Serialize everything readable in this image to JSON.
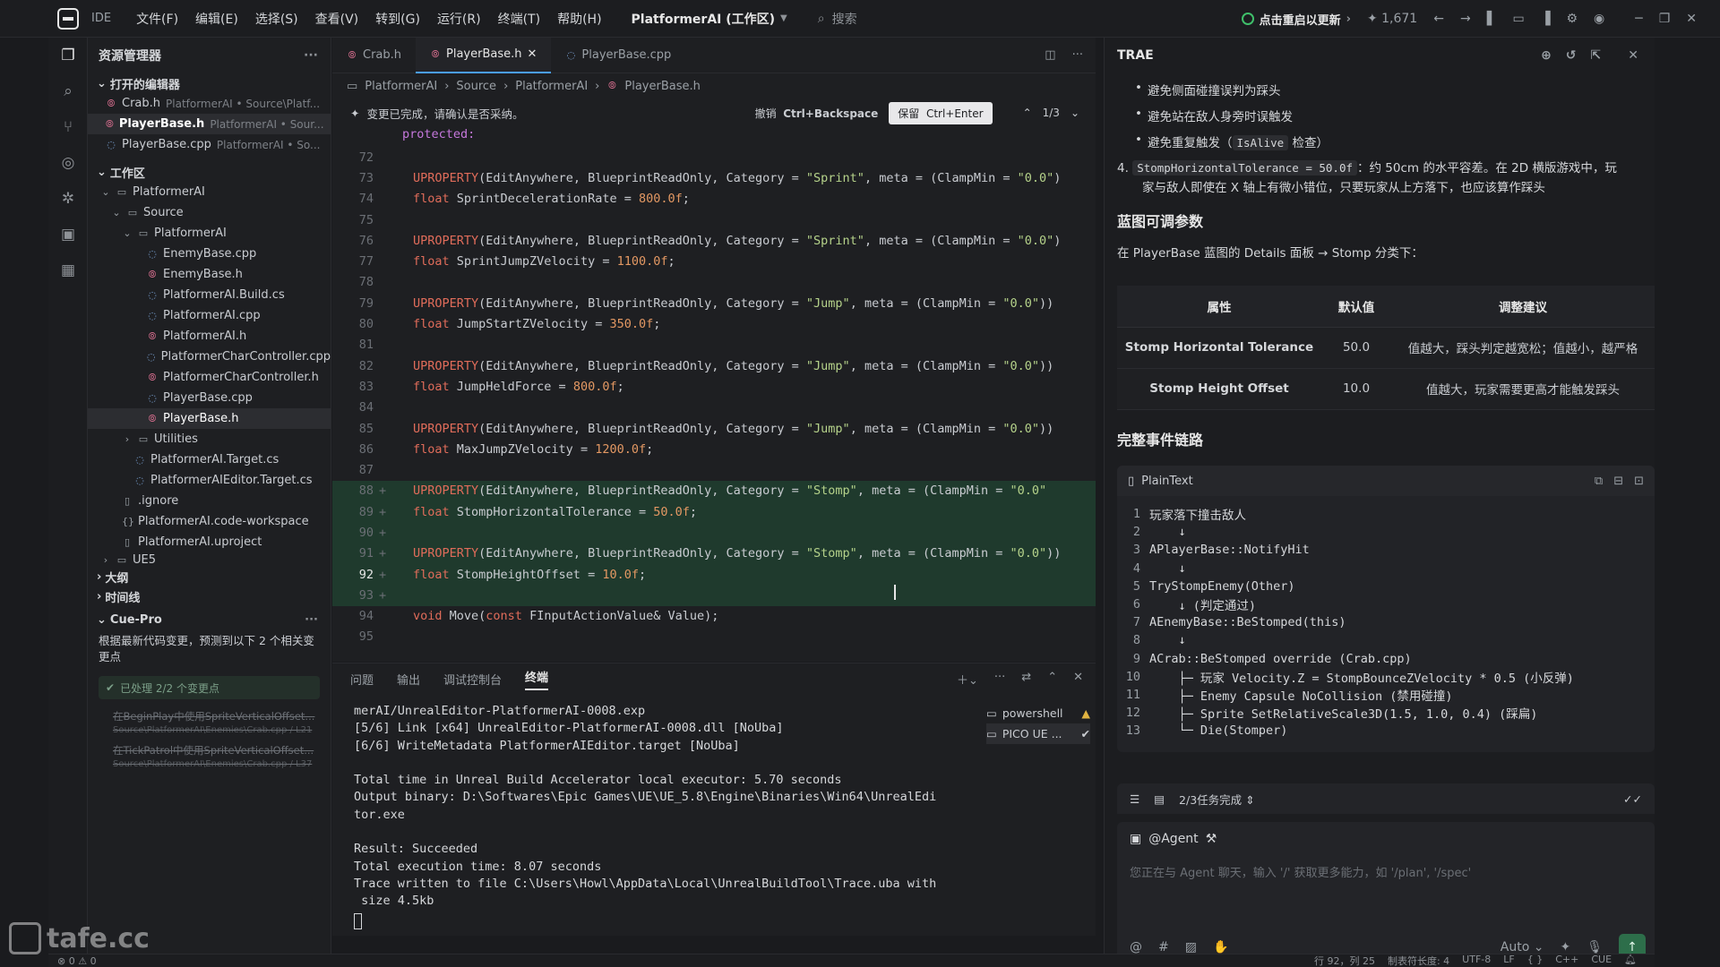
{
  "titlebar": {
    "badge": "IDE",
    "menu": [
      "文件(F)",
      "编辑(E)",
      "选择(S)",
      "查看(V)",
      "转到(G)",
      "运行(R)",
      "终端(T)",
      "帮助(H)"
    ],
    "project": "PlatformerAI (工作区)",
    "search": "搜索",
    "update": "点击重启以更新",
    "count": "1,671"
  },
  "sidebar": {
    "title": "资源管理器",
    "open_editors_title": "打开的编辑器",
    "open_editors": [
      {
        "name": "Crab.h",
        "path": "PlatformerAI • Source\\Platf..."
      },
      {
        "name": "PlayerBase.h",
        "path": "PlatformerAI • Sour..."
      },
      {
        "name": "PlayerBase.cpp",
        "path": "PlatformerAI • So..."
      }
    ],
    "workspace_title": "工作区",
    "tree": {
      "root": "PlatformerAI",
      "source": "Source",
      "sub": "PlatformerAI",
      "files": [
        "EnemyBase.cpp",
        "EnemyBase.h",
        "PlatformerAI.Build.cs",
        "PlatformerAI.cpp",
        "PlatformerAI.h",
        "PlatformerCharController.cpp",
        "PlatformerCharController.h",
        "PlayerBase.cpp",
        "PlayerBase.h"
      ],
      "utilities": "Utilities",
      "targets": [
        "PlatformerAI.Target.cs",
        "PlatformerAIEditor.Target.cs"
      ],
      "root_files": [
        ".ignore",
        "PlatformerAI.code-workspace",
        "PlatformerAI.uproject"
      ],
      "ue5": "UE5"
    },
    "outline": "大纲",
    "timeline": "时间线",
    "cue": {
      "title": "Cue-Pro",
      "note": "根据最新代码变更，预测到以下 2 个相关变更点",
      "done": "已处理 2/2 个变更点",
      "items": [
        {
          "text": "在BeginPlay中使用SpriteVerticalOffset...",
          "path": "Source\\PlatformerAI\\Enemies\\Crab.cpp / L21"
        },
        {
          "text": "在TickPatrol中使用SpriteVerticalOffset...",
          "path": "Source\\PlatformerAI\\Enemies\\Crab.cpp / L37"
        }
      ]
    }
  },
  "editor": {
    "tabs": [
      "Crab.h",
      "PlayerBase.h",
      "PlayerBase.cpp"
    ],
    "breadcrumb": [
      "PlatformerAI",
      "Source",
      "PlatformerAI",
      "PlayerBase.h"
    ],
    "change_bar": {
      "message": "变更已完成，请确认是否采纳。",
      "undo": "撤销",
      "undo_key": "Ctrl+Backspace",
      "keep": "保留",
      "keep_key": "Ctrl+Enter",
      "counter": "1/3"
    },
    "sticky": "protected:",
    "lines": [
      {
        "n": "72",
        "code": ""
      },
      {
        "n": "73",
        "code": "UPROPERTY(EditAnywhere, BlueprintReadOnly, Category = \"Sprint\", meta = (ClampMin = \"0.0\")"
      },
      {
        "n": "74",
        "code": "float SprintDecelerationRate = 800.0f;"
      },
      {
        "n": "75",
        "code": ""
      },
      {
        "n": "76",
        "code": "UPROPERTY(EditAnywhere, BlueprintReadOnly, Category = \"Sprint\", meta = (ClampMin = \"0.0\")"
      },
      {
        "n": "77",
        "code": "float SprintJumpZVelocity = 1100.0f;"
      },
      {
        "n": "78",
        "code": ""
      },
      {
        "n": "79",
        "code": "UPROPERTY(EditAnywhere, BlueprintReadOnly, Category = \"Jump\", meta = (ClampMin = \"0.0\"))"
      },
      {
        "n": "80",
        "code": "float JumpStartZVelocity = 350.0f;"
      },
      {
        "n": "81",
        "code": ""
      },
      {
        "n": "82",
        "code": "UPROPERTY(EditAnywhere, BlueprintReadOnly, Category = \"Jump\", meta = (ClampMin = \"0.0\"))"
      },
      {
        "n": "83",
        "code": "float JumpHeldForce = 800.0f;"
      },
      {
        "n": "84",
        "code": ""
      },
      {
        "n": "85",
        "code": "UPROPERTY(EditAnywhere, BlueprintReadOnly, Category = \"Jump\", meta = (ClampMin = \"0.0\"))"
      },
      {
        "n": "86",
        "code": "float MaxJumpZVelocity = 1200.0f;"
      },
      {
        "n": "87",
        "code": ""
      },
      {
        "n": "88",
        "code": "UPROPERTY(EditAnywhere, BlueprintReadOnly, Category = \"Stomp\", meta = (ClampMin = \"0.0\"",
        "added": true
      },
      {
        "n": "89",
        "code": "float StompHorizontalTolerance = 50.0f;",
        "added": true
      },
      {
        "n": "90",
        "code": "",
        "added": true
      },
      {
        "n": "91",
        "code": "UPROPERTY(EditAnywhere, BlueprintReadOnly, Category = \"Stomp\", meta = (ClampMin = \"0.0\"))",
        "added": true
      },
      {
        "n": "92",
        "code": "float StompHeightOffset = 10.0f;",
        "added": true,
        "current": true
      },
      {
        "n": "93",
        "code": "",
        "added": true
      },
      {
        "n": "94",
        "code": "void Move(const FInputActionValue& Value);"
      },
      {
        "n": "95",
        "code": ""
      }
    ]
  },
  "terminal": {
    "tabs": [
      "问题",
      "输出",
      "调试控制台",
      "终端"
    ],
    "output": "merAI/UnrealEditor-PlatformerAI-0008.exp\n[5/6] Link [x64] UnrealEditor-PlatformerAI-0008.dll [NoUba]\n[6/6] WriteMetadata PlatformerAIEditor.target [NoUba]\n\nTotal time in Unreal Build Accelerator local executor: 5.70 seconds\nOutput binary: D:\\Softwares\\Epic Games\\UE\\UE_5.8\\Engine\\Binaries\\Win64\\UnrealEdi\ntor.exe\n\nResult: Succeeded\nTotal execution time: 8.07 seconds\nTrace written to file C:\\Users\\Howl\\AppData\\Local\\UnrealBuildTool\\Trace.uba with\n size 4.5kb",
    "sessions": [
      "powershell",
      "PICO UE ..."
    ]
  },
  "trae": {
    "title": "TRAE",
    "bullets": [
      "避免侧面碰撞误判为踩头",
      "避免站在敌人身旁时误触发"
    ],
    "bullet3_pre": "避免重复触发（",
    "bullet3_code": "IsAlive",
    "bullet3_post": " 检查）",
    "item4_num": "4.",
    "item4_code": "StompHorizontalTolerance = 50.0f",
    "item4_text": "：约 50cm 的水平容差。在 2D 横版游戏中，玩",
    "item4_text2": "家与敌人即使在 X 轴上有微小错位，只要玩家从上方落下，也应该算作踩头",
    "h_params": "蓝图可调参数",
    "params_desc": "在 PlayerBase 蓝图的 Details 面板 → Stomp 分类下：",
    "table": {
      "headers": [
        "属性",
        "默认值",
        "调整建议"
      ],
      "rows": [
        [
          "Stomp Horizontal Tolerance",
          "50.0",
          "值越大，踩头判定越宽松；值越小，越严格"
        ],
        [
          "Stomp Height Offset",
          "10.0",
          "值越大，玩家需要更高才能触发踩头"
        ]
      ]
    },
    "h_chain": "完整事件链路",
    "code_lang": "PlainText",
    "code_lines": [
      {
        "n": "1",
        "t": "玩家落下撞击敌人"
      },
      {
        "n": "2",
        "t": "    ↓"
      },
      {
        "n": "3",
        "t": "APlayerBase::NotifyHit"
      },
      {
        "n": "4",
        "t": "    ↓"
      },
      {
        "n": "5",
        "t": "TryStompEnemy(Other)"
      },
      {
        "n": "6",
        "t": "    ↓ (判定通过)"
      },
      {
        "n": "7",
        "t": "AEnemyBase::BeStomped(this)"
      },
      {
        "n": "8",
        "t": "    ↓"
      },
      {
        "n": "9",
        "t": "ACrab::BeStomped override (Crab.cpp)"
      },
      {
        "n": "10",
        "t": "    ├─ 玩家 Velocity.Z = StompBounceZVelocity * 0.5 (小反弹)"
      },
      {
        "n": "11",
        "t": "    ├─ Enemy Capsule NoCollision (禁用碰撞)"
      },
      {
        "n": "12",
        "t": "    ├─ Sprite SetRelativeScale3D(1.5, 1.0, 0.4) (踩扁)"
      },
      {
        "n": "13",
        "t": "    └─ Die(Stomper)"
      }
    ],
    "tasks": "2/3任务完成",
    "agent_tag": "@Agent",
    "agent_placeholder": "您正在与 Agent 聊天，输入 '/' 获取更多能力，如 '/plan', '/spec'",
    "mode": "Auto"
  },
  "statusbar": {
    "errors": "0",
    "warnings": "0",
    "position": "行 92，列 25",
    "tab_size": "制表符长度: 4",
    "encoding": "UTF-8",
    "eol": "LF",
    "lang": "C++",
    "cue": "CUE"
  },
  "watermark": "tafe.cc"
}
